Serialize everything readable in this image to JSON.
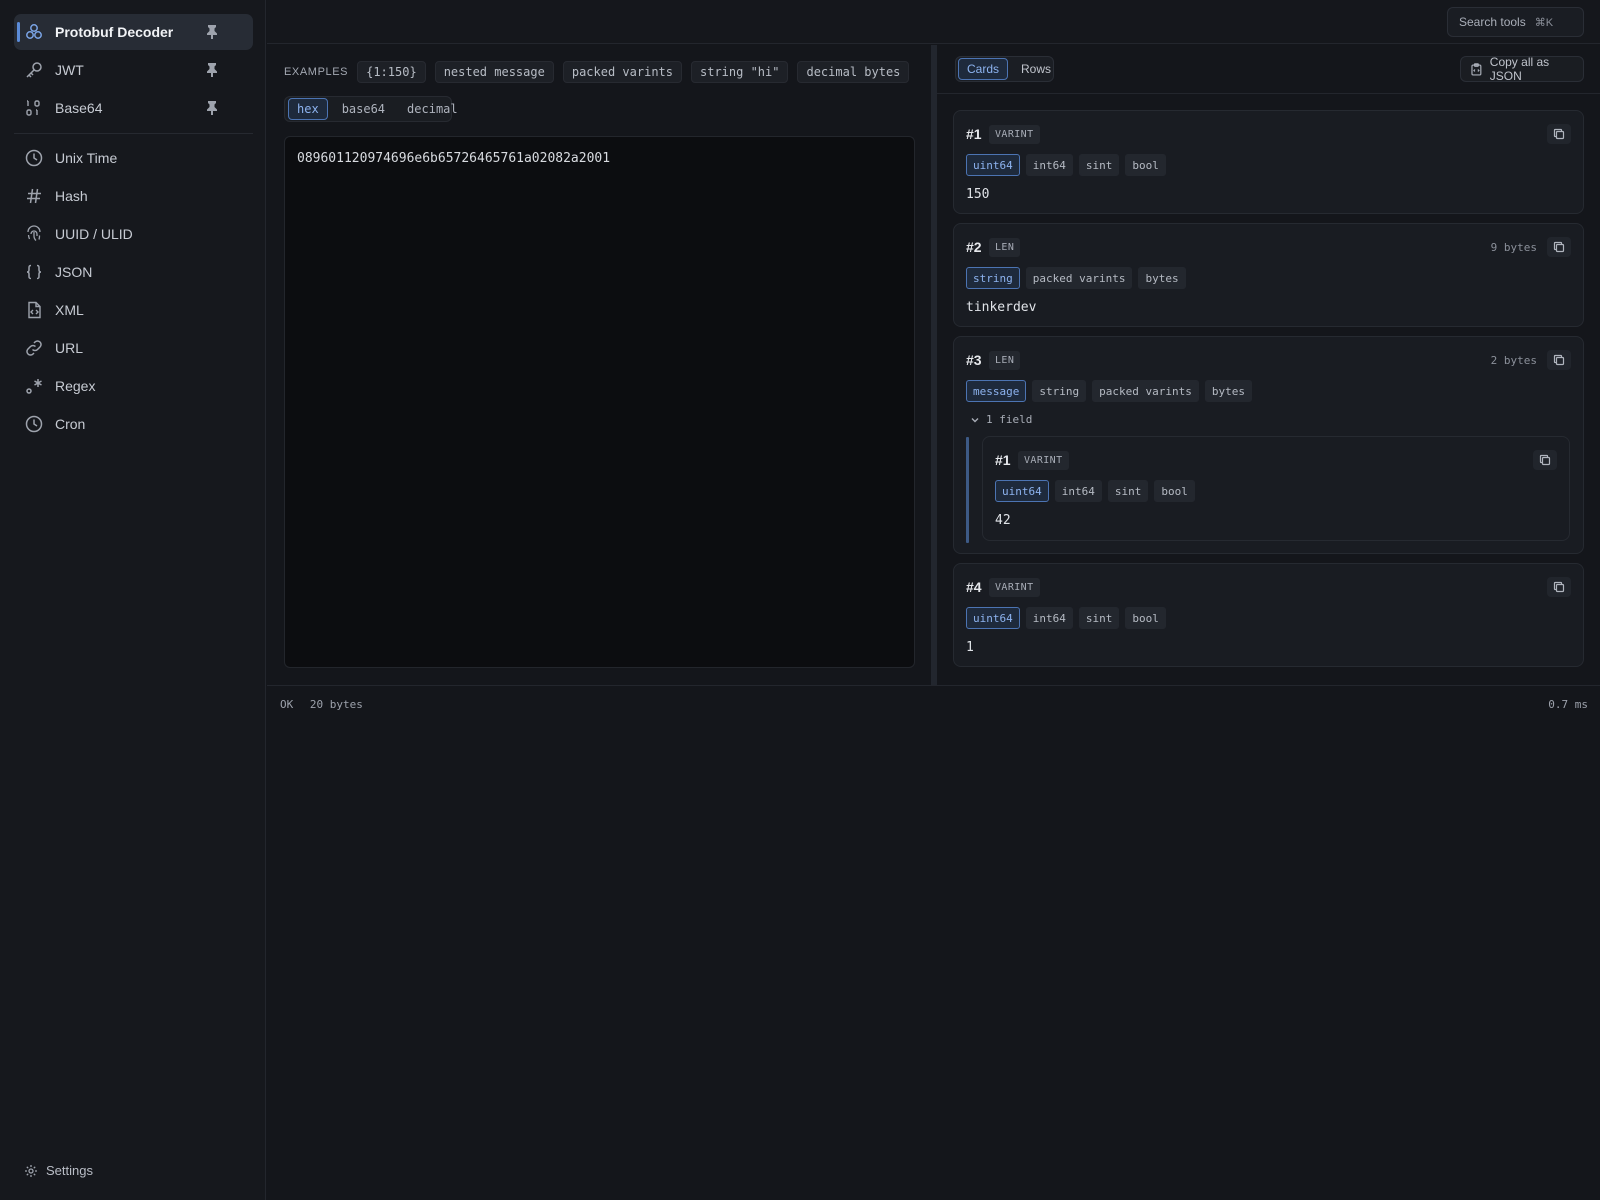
{
  "sidebar": {
    "pinned": [
      {
        "label": "Protobuf Decoder",
        "icon": "protobuf-icon",
        "active": true
      },
      {
        "label": "JWT",
        "icon": "key-icon"
      },
      {
        "label": "Base64",
        "icon": "binary-icon"
      }
    ],
    "tools": [
      {
        "label": "Unix Time",
        "icon": "clock-icon"
      },
      {
        "label": "Hash",
        "icon": "hash-icon"
      },
      {
        "label": "UUID / ULID",
        "icon": "fingerprint-icon"
      },
      {
        "label": "JSON",
        "icon": "braces-icon"
      },
      {
        "label": "XML",
        "icon": "file-code-icon"
      },
      {
        "label": "URL",
        "icon": "link-icon"
      },
      {
        "label": "Regex",
        "icon": "regex-icon"
      },
      {
        "label": "Cron",
        "icon": "clock-icon"
      }
    ],
    "settings_label": "Settings"
  },
  "topbar": {
    "search_label": "Search tools",
    "search_shortcut": "⌘K"
  },
  "input": {
    "examples_label": "EXAMPLES",
    "examples": [
      "{1:150}",
      "nested message",
      "packed varints",
      "string \"hi\"",
      "decimal bytes"
    ],
    "formats": [
      "hex",
      "base64",
      "decimal"
    ],
    "active_format": "hex",
    "value": "089601120974696e6b65726465761a02082a2001"
  },
  "output": {
    "views": [
      "Cards",
      "Rows"
    ],
    "active_view": "Cards",
    "copy_all_label": "Copy all as JSON",
    "fields": [
      {
        "num": "#1",
        "wire": "VARINT",
        "types": [
          "uint64",
          "int64",
          "sint",
          "bool"
        ],
        "value": "150"
      },
      {
        "num": "#2",
        "wire": "LEN",
        "bytes": "9 bytes",
        "types": [
          "string",
          "packed varints",
          "bytes"
        ],
        "value": "tinkerdev"
      },
      {
        "num": "#3",
        "wire": "LEN",
        "bytes": "2 bytes",
        "types": [
          "message",
          "string",
          "packed varints",
          "bytes"
        ],
        "expander": "1 field",
        "nested": {
          "num": "#1",
          "wire": "VARINT",
          "types": [
            "uint64",
            "int64",
            "sint",
            "bool"
          ],
          "value": "42"
        }
      },
      {
        "num": "#4",
        "wire": "VARINT",
        "types": [
          "uint64",
          "int64",
          "sint",
          "bool"
        ],
        "value": "1"
      }
    ]
  },
  "status": {
    "state": "OK",
    "size": "20 bytes",
    "time": "0.7 ms"
  },
  "colors": {
    "accent": "#5b8bd8",
    "background": "#14161b",
    "sidebar": "#16181d",
    "card": "#191c22"
  }
}
